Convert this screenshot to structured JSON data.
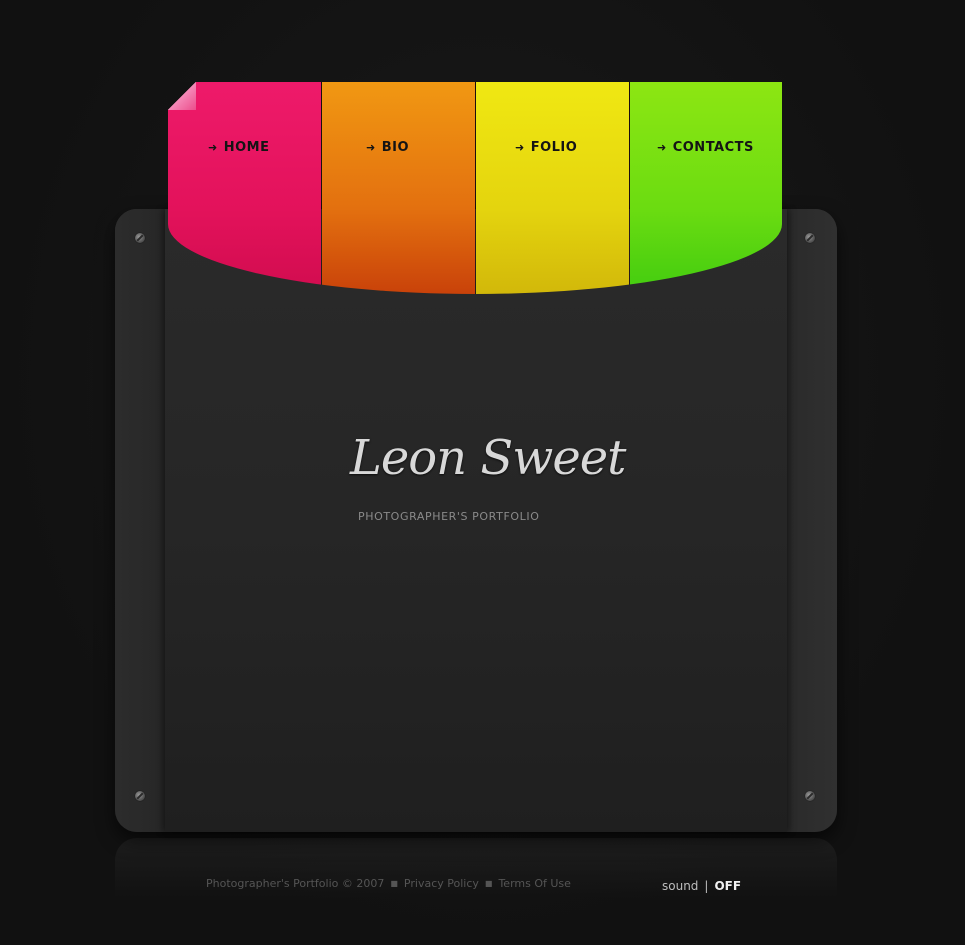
{
  "nav": {
    "items": [
      {
        "label": "HOME",
        "icon": "arrow-right-icon",
        "color": "#e3125b"
      },
      {
        "label": "BIO",
        "icon": "arrow-right-icon",
        "color": "#e3700f"
      },
      {
        "label": "FOLIO",
        "icon": "arrow-right-icon",
        "color": "#e4d40e"
      },
      {
        "label": "CONTACTS",
        "icon": "arrow-right-icon",
        "color": "#6bdc11"
      }
    ],
    "arrow_glyph": "➜"
  },
  "logo": {
    "name": "Leon Sweet",
    "subtitle": "PHOTOGRAPHER'S PORTFOLIO"
  },
  "footer": {
    "copyright": "Photographer's Portfolio © 2007",
    "privacy_label": "Privacy Policy",
    "terms_label": "Terms Of Use",
    "separator": "■"
  },
  "sound": {
    "label": "sound",
    "divider": "|",
    "state": "OFF"
  }
}
